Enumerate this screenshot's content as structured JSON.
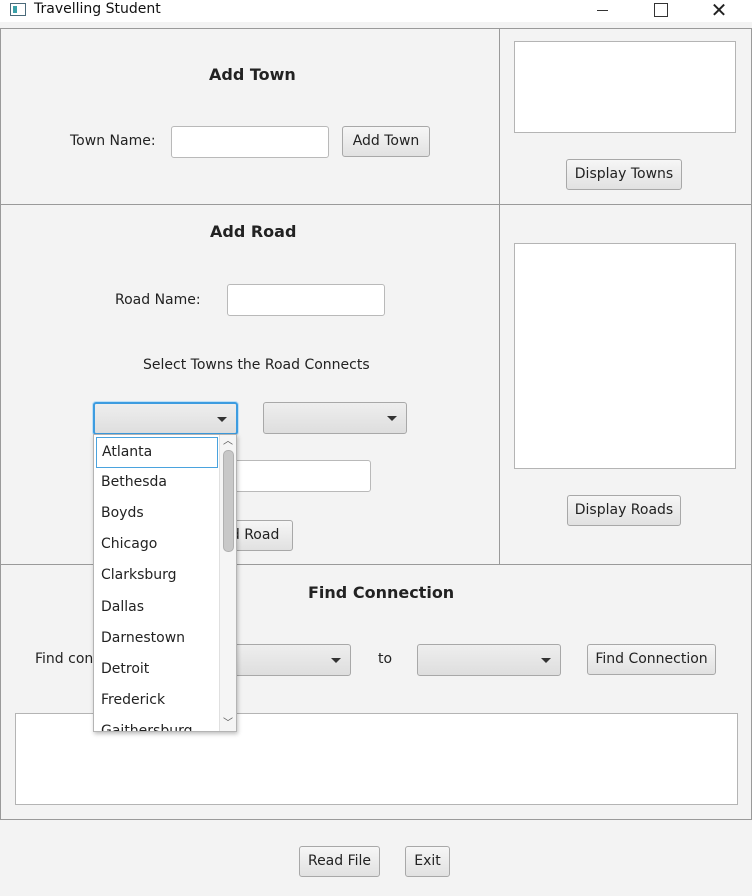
{
  "window": {
    "title": "Travelling Student"
  },
  "add_town": {
    "heading": "Add Town",
    "name_label": "Town Name:",
    "name_value": "",
    "add_button": "Add Town"
  },
  "towns_display": {
    "button": "Display Towns"
  },
  "add_road": {
    "heading": "Add Road",
    "name_label": "Road Name:",
    "name_value": "",
    "select_label": "Select Towns the Road Connects",
    "from_value": "",
    "to_value": "",
    "distance_value": "",
    "add_button": "Add Road"
  },
  "roads_display": {
    "button": "Display Roads"
  },
  "town_dropdown": {
    "selected": "Atlanta",
    "options": [
      "Atlanta",
      "Bethesda",
      "Boyds",
      "Chicago",
      "Clarksburg",
      "Dallas",
      "Darnestown",
      "Detroit",
      "Frederick",
      "Gaithersburg"
    ]
  },
  "find_connection": {
    "heading": "Find Connection",
    "find_label": "Find connection from",
    "to_label": "to",
    "from_value": "",
    "to_value": "",
    "button": "Find Connection",
    "result_text": ""
  },
  "footer": {
    "read_file": "Read File",
    "exit": "Exit"
  }
}
